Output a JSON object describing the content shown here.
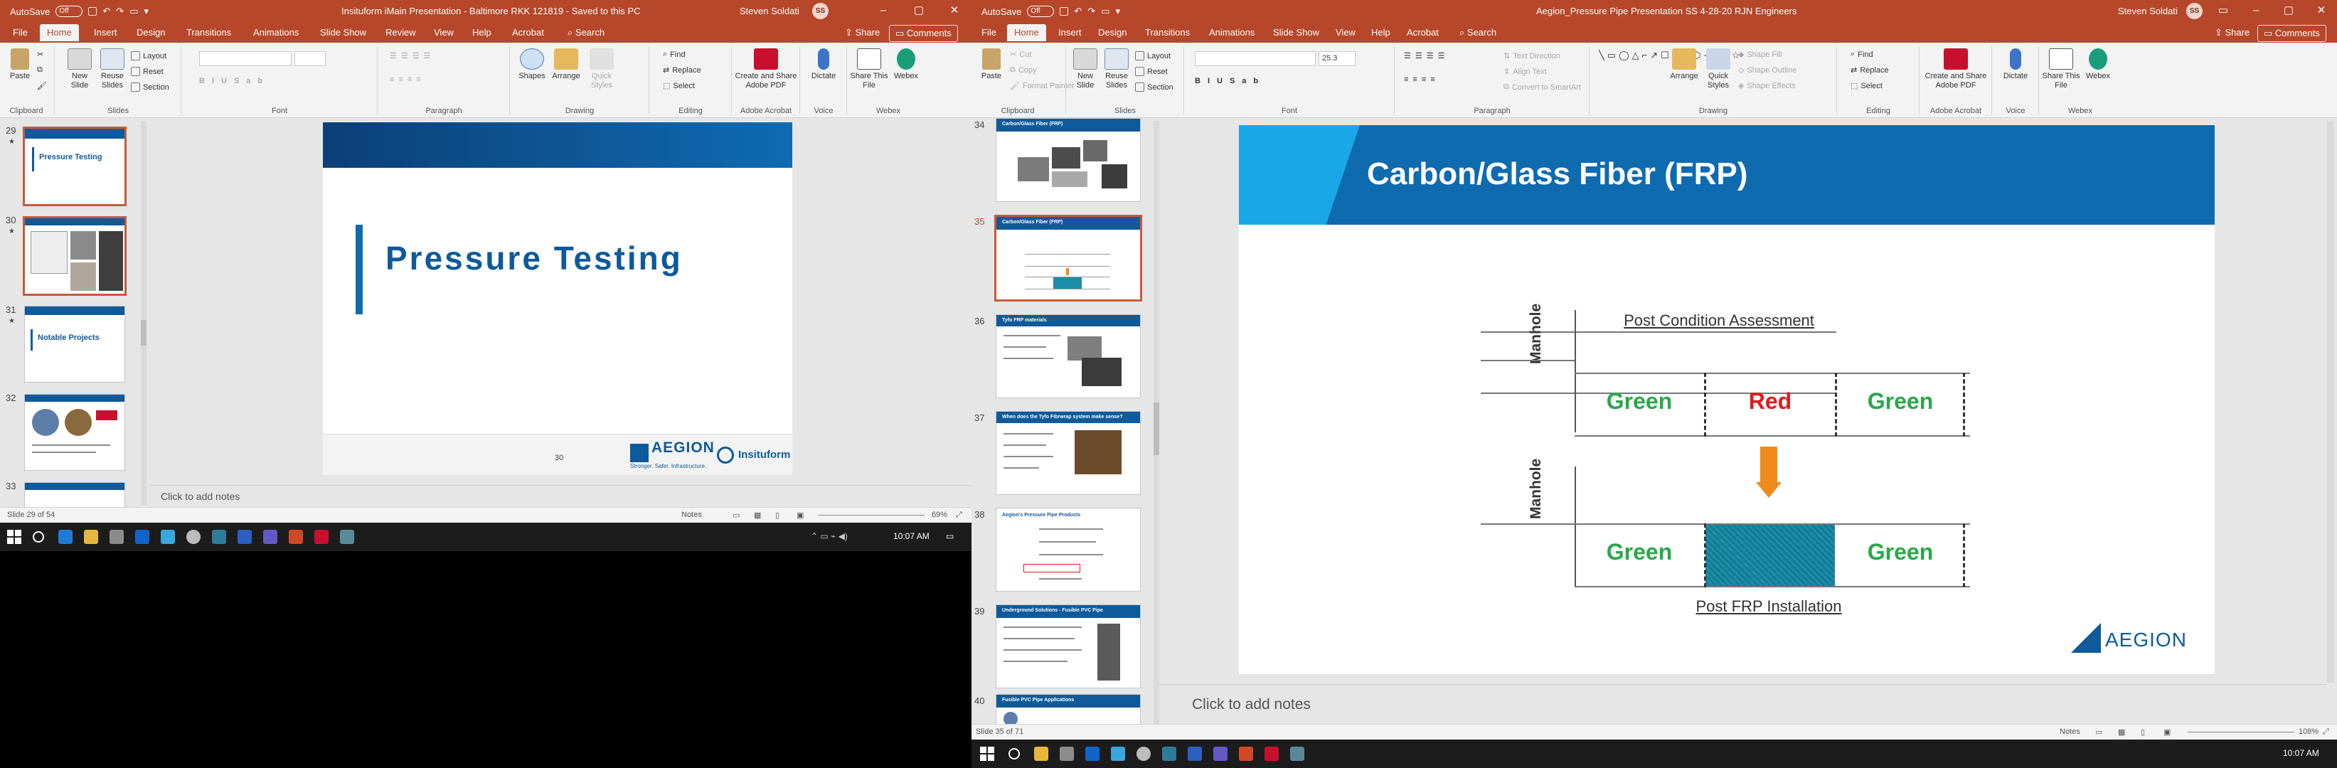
{
  "colors": {
    "accent": "#b7472a",
    "brand_blue": "#0e5a9a",
    "green_label": "#2aa84a",
    "red_label": "#e01b1b",
    "arrow": "#f08a1c"
  },
  "left_window": {
    "autosave": "AutoSave",
    "autosave_state": "Off",
    "title": "Insituform iMain Presentation - Baltimore RKK 121819  -  Saved to this PC",
    "user": "Steven Soldati",
    "user_initials": "SS",
    "tabs": [
      "File",
      "Home",
      "Insert",
      "Design",
      "Transitions",
      "Animations",
      "Slide Show",
      "Review",
      "View",
      "Help",
      "Acrobat"
    ],
    "active_tab": "Home",
    "search": "Search",
    "share": "Share",
    "comments": "Comments",
    "ribbon": {
      "groups": [
        "Clipboard",
        "Slides",
        "Font",
        "Paragraph",
        "Drawing",
        "Editing",
        "Adobe Acrobat",
        "Voice",
        "Webex"
      ],
      "paste": "Paste",
      "new_slide": "New Slide",
      "reuse_slides": "Reuse Slides",
      "layout": "Layout",
      "reset": "Reset",
      "section": "Section",
      "shapes": "Shapes",
      "arrange": "Arrange",
      "quick_styles": "Quick Styles",
      "find": "Find",
      "replace": "Replace",
      "select": "Select",
      "create_share_pdf": "Create and Share Adobe PDF",
      "dictate": "Dictate",
      "share_this_file": "Share This File",
      "webex": "Webex"
    },
    "thumbnails": [
      {
        "num": "29",
        "star": "★",
        "title": "Pressure Testing"
      },
      {
        "num": "30",
        "star": "★",
        "title": ""
      },
      {
        "num": "31",
        "star": "★",
        "title": "Notable Projects"
      },
      {
        "num": "32",
        "star": "",
        "title": ""
      },
      {
        "num": "33",
        "star": "",
        "title": ""
      }
    ],
    "slide": {
      "title": "Pressure Testing",
      "page_number": "30",
      "logo1": "AEGION",
      "logo1_tagline": "Stronger. Safer. Infrastructure.",
      "logo2": "Insituform"
    },
    "notes": "Click to add notes",
    "status": {
      "slide": "Slide 29 of 54",
      "notes": "Notes",
      "zoom": "69%"
    }
  },
  "right_window": {
    "autosave": "AutoSave",
    "autosave_state": "Off",
    "title": "Aegion_Pressure Pipe Presentation SS 4-28-20 RJN Engineers",
    "user": "Steven Soldati",
    "user_initials": "SS",
    "tabs": [
      "File",
      "Home",
      "Insert",
      "Design",
      "Transitions",
      "Animations",
      "Slide Show",
      "View",
      "Help",
      "Acrobat"
    ],
    "active_tab": "Home",
    "search": "Search",
    "share": "Share",
    "comments": "Comments",
    "ribbon": {
      "groups": [
        "Clipboard",
        "Slides",
        "Font",
        "Paragraph",
        "Drawing",
        "Editing",
        "Adobe Acrobat",
        "Voice",
        "Webex"
      ],
      "paste": "Paste",
      "cut": "Cut",
      "copy": "Copy",
      "format_painter": "Format Painter",
      "new_slide": "New Slide",
      "reuse_slides": "Reuse Slides",
      "layout": "Layout",
      "reset": "Reset",
      "section": "Section",
      "font_size": "25.3",
      "text_direction": "Text Direction",
      "align_text": "Align Text",
      "convert_smartart": "Convert to SmartArt",
      "arrange": "Arrange",
      "quick_styles": "Quick Styles",
      "shape_fill": "Shape Fill",
      "shape_outline": "Shape Outline",
      "shape_effects": "Shape Effects",
      "find": "Find",
      "replace": "Replace",
      "select": "Select",
      "create_share_pdf": "Create and Share Adobe PDF",
      "dictate": "Dictate",
      "share_this_file": "Share This File",
      "webex": "Webex"
    },
    "thumbnails": [
      {
        "num": "34",
        "title": "Carbon/Glass Fiber (FRP)"
      },
      {
        "num": "35",
        "title": "Carbon/Glass Fiber (FRP)"
      },
      {
        "num": "36",
        "title": "Tyfo FRP materials"
      },
      {
        "num": "37",
        "title": "When does the Tyfo Fibrwrap system make sense?"
      },
      {
        "num": "38",
        "title": "Aegion's Pressure Pipe Products"
      },
      {
        "num": "39",
        "title": "Underground Solutions - Fusible PVC Pipe"
      },
      {
        "num": "40",
        "title": "Fusible PVC Pipe Applications"
      }
    ],
    "slide": {
      "title": "Carbon/Glass Fiber (FRP)",
      "top_heading": "Post Condition Assessment",
      "bottom_heading": "Post FRP Installation",
      "manhole": "Manhole",
      "top_cells": [
        "Green",
        "Red",
        "Green"
      ],
      "bottom_cells": [
        "Green",
        "",
        "Green"
      ],
      "logo": "AEGION"
    },
    "notes": "Click to add notes",
    "status": {
      "slide": "Slide 35 of 71",
      "notes": "Notes",
      "zoom": "108%"
    }
  },
  "taskbar_left": {
    "time": "10:07 AM"
  },
  "taskbar_right": {
    "time": "10:07 AM"
  }
}
